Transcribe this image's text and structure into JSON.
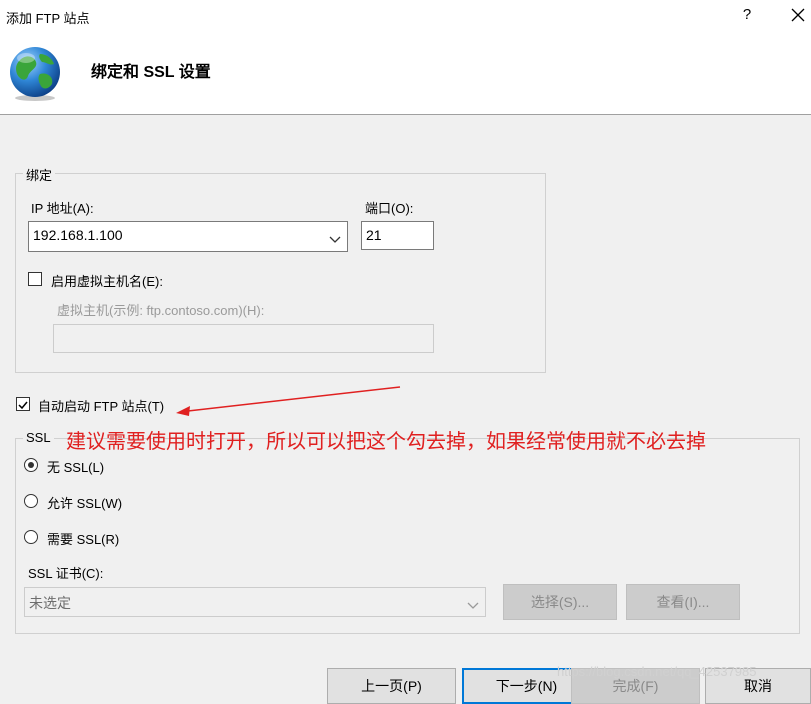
{
  "window": {
    "title": "添加 FTP 站点",
    "help_label": "?",
    "close_icon": "close-icon"
  },
  "header": {
    "title": "绑定和 SSL 设置",
    "icon": "globe-icon"
  },
  "binding": {
    "legend": "绑定",
    "ip_label": "IP 地址(A):",
    "ip_value": "192.168.1.100",
    "port_label": "端口(O):",
    "port_value": "21",
    "virtual_host_checkbox_label": "启用虚拟主机名(E):",
    "virtual_host_checked": false,
    "virtual_host_label": "虚拟主机(示例: ftp.contoso.com)(H):",
    "virtual_host_value": ""
  },
  "autostart": {
    "label": "自动启动 FTP 站点(T)",
    "checked": true
  },
  "ssl": {
    "legend": "SSL",
    "options": [
      "无 SSL(L)",
      "允许 SSL(W)",
      "需要 SSL(R)"
    ],
    "selected_index": 0,
    "cert_label": "SSL 证书(C):",
    "cert_value": "未选定",
    "select_button": "选择(S)...",
    "view_button": "查看(I)..."
  },
  "footer": {
    "prev_button": "上一页(P)",
    "next_button": "下一步(N)",
    "finish_button": "完成(F)",
    "cancel_button": "取消"
  },
  "annotation": {
    "text": "建议需要使用时打开，所以可以把这个勾去掉，如果经常使用就不必去掉",
    "color": "#e02020"
  },
  "watermark": "https://blog.csdn.net/qq_42537985",
  "colors": {
    "accent": "#0078d7",
    "annotation": "#e02020"
  }
}
